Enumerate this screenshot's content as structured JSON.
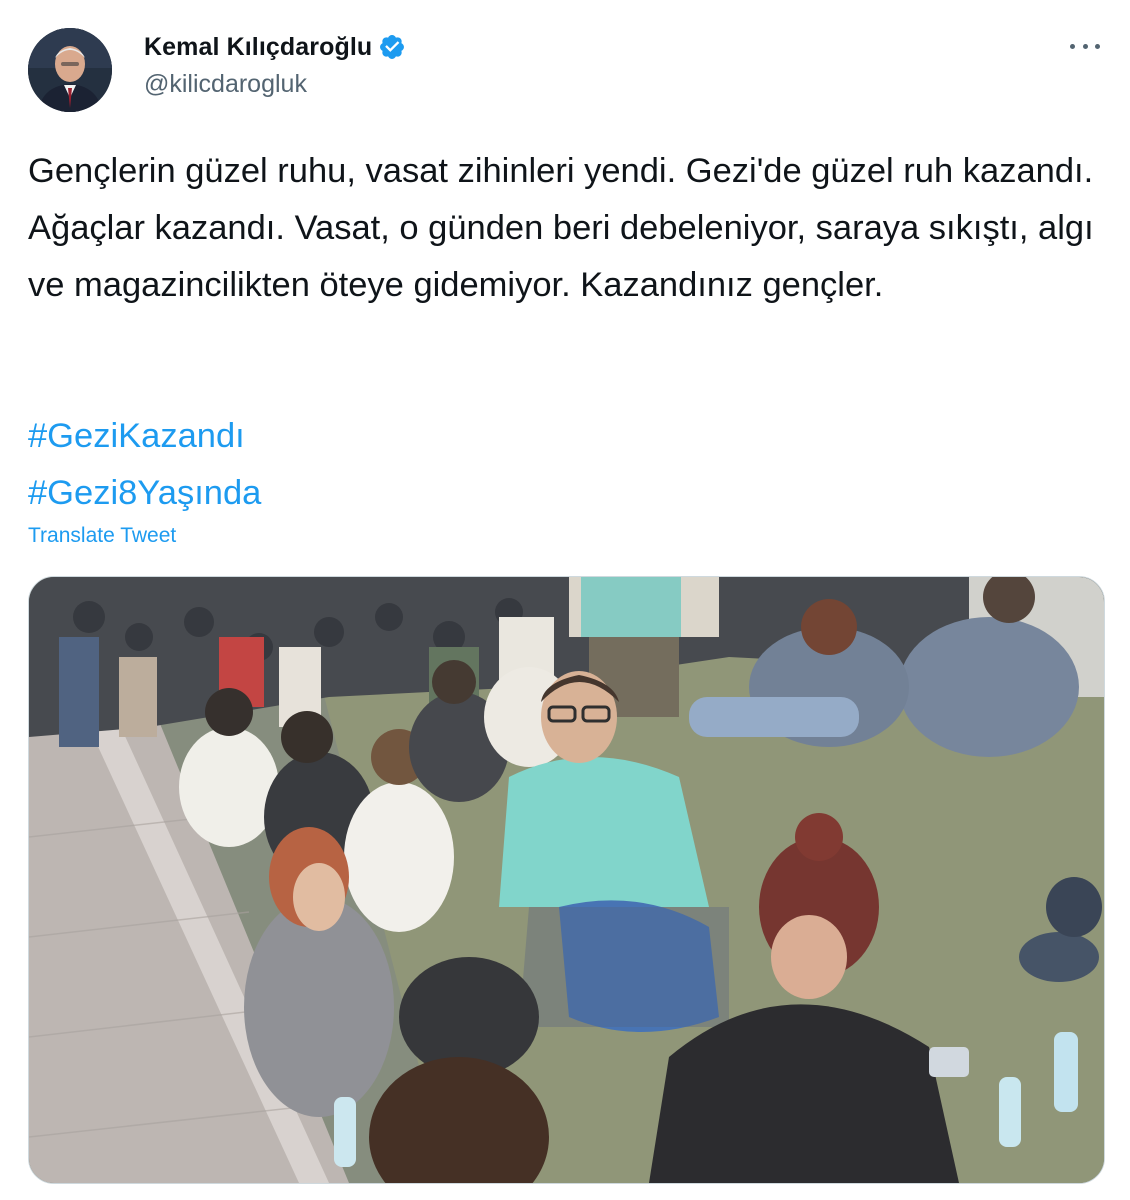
{
  "author": {
    "display_name": "Kemal Kılıçdaroğlu",
    "handle": "@kilicdarogluk",
    "verified": true,
    "verified_icon": "verified-badge-icon"
  },
  "menu": {
    "icon": "more-dots-icon"
  },
  "tweet": {
    "text": "Gençlerin güzel ruhu, vasat zihinleri yendi. Gezi'de güzel ruh kazandı. Ağaçlar kazandı. Vasat, o günden beri debeleniyor, saraya sıkıştı, algı ve magazincilikten öteye gidemiyor. Kazandınız gençler.",
    "hashtags": [
      "#GeziKazandı",
      "#Gezi8Yaşında"
    ],
    "translate_label": "Translate Tweet"
  },
  "colors": {
    "link": "#1d9bf0",
    "text": "#0f1419",
    "secondary": "#536471",
    "border": "#cfd9de"
  }
}
